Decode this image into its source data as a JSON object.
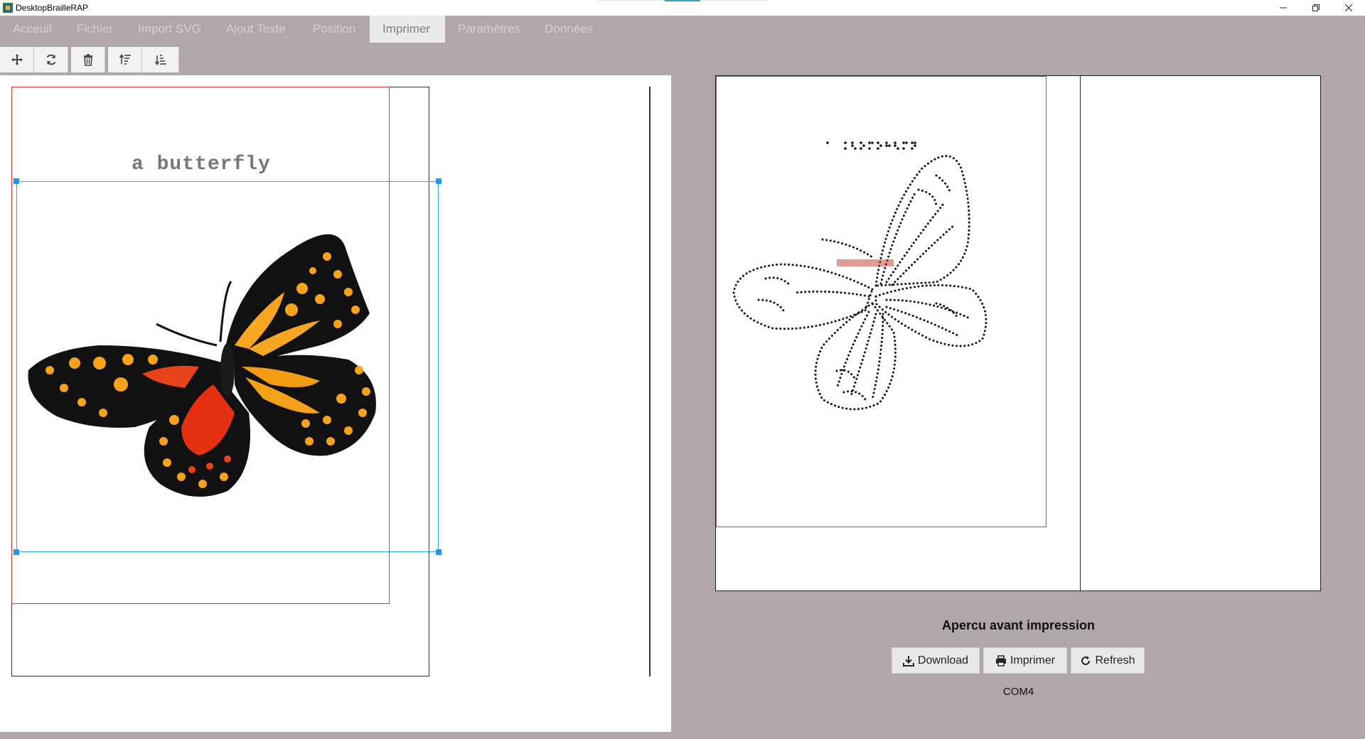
{
  "window": {
    "title": "DesktopBrailleRAP",
    "controls": [
      "minimize",
      "maximize",
      "close"
    ]
  },
  "tabs": [
    {
      "label": "Acceuil",
      "active": false
    },
    {
      "label": "Fichier",
      "active": false
    },
    {
      "label": "Import SVG",
      "active": false
    },
    {
      "label": "Ajout Texte",
      "active": false
    },
    {
      "label": "Position",
      "active": false
    },
    {
      "label": "Imprimer",
      "active": true
    },
    {
      "label": "Paramètres",
      "active": false
    },
    {
      "label": "Données",
      "active": false
    }
  ],
  "toolbar": {
    "icons": [
      "move-icon",
      "rotate-icon",
      "trash-icon",
      "sort-ascending-icon",
      "sort-descending-icon"
    ]
  },
  "canvas": {
    "text_object": "a butterfly",
    "image_object": "butterfly-image"
  },
  "preview": {
    "title": "Apercu avant impression",
    "buttons": {
      "download": "Download",
      "print": "Imprimer",
      "refresh": "Refresh"
    },
    "port": "COM4"
  },
  "colors": {
    "background": "#b0a8a8",
    "margin_outline": "#e53935",
    "selection": "#2ea3e8",
    "active_tab": "#ebebeb"
  }
}
